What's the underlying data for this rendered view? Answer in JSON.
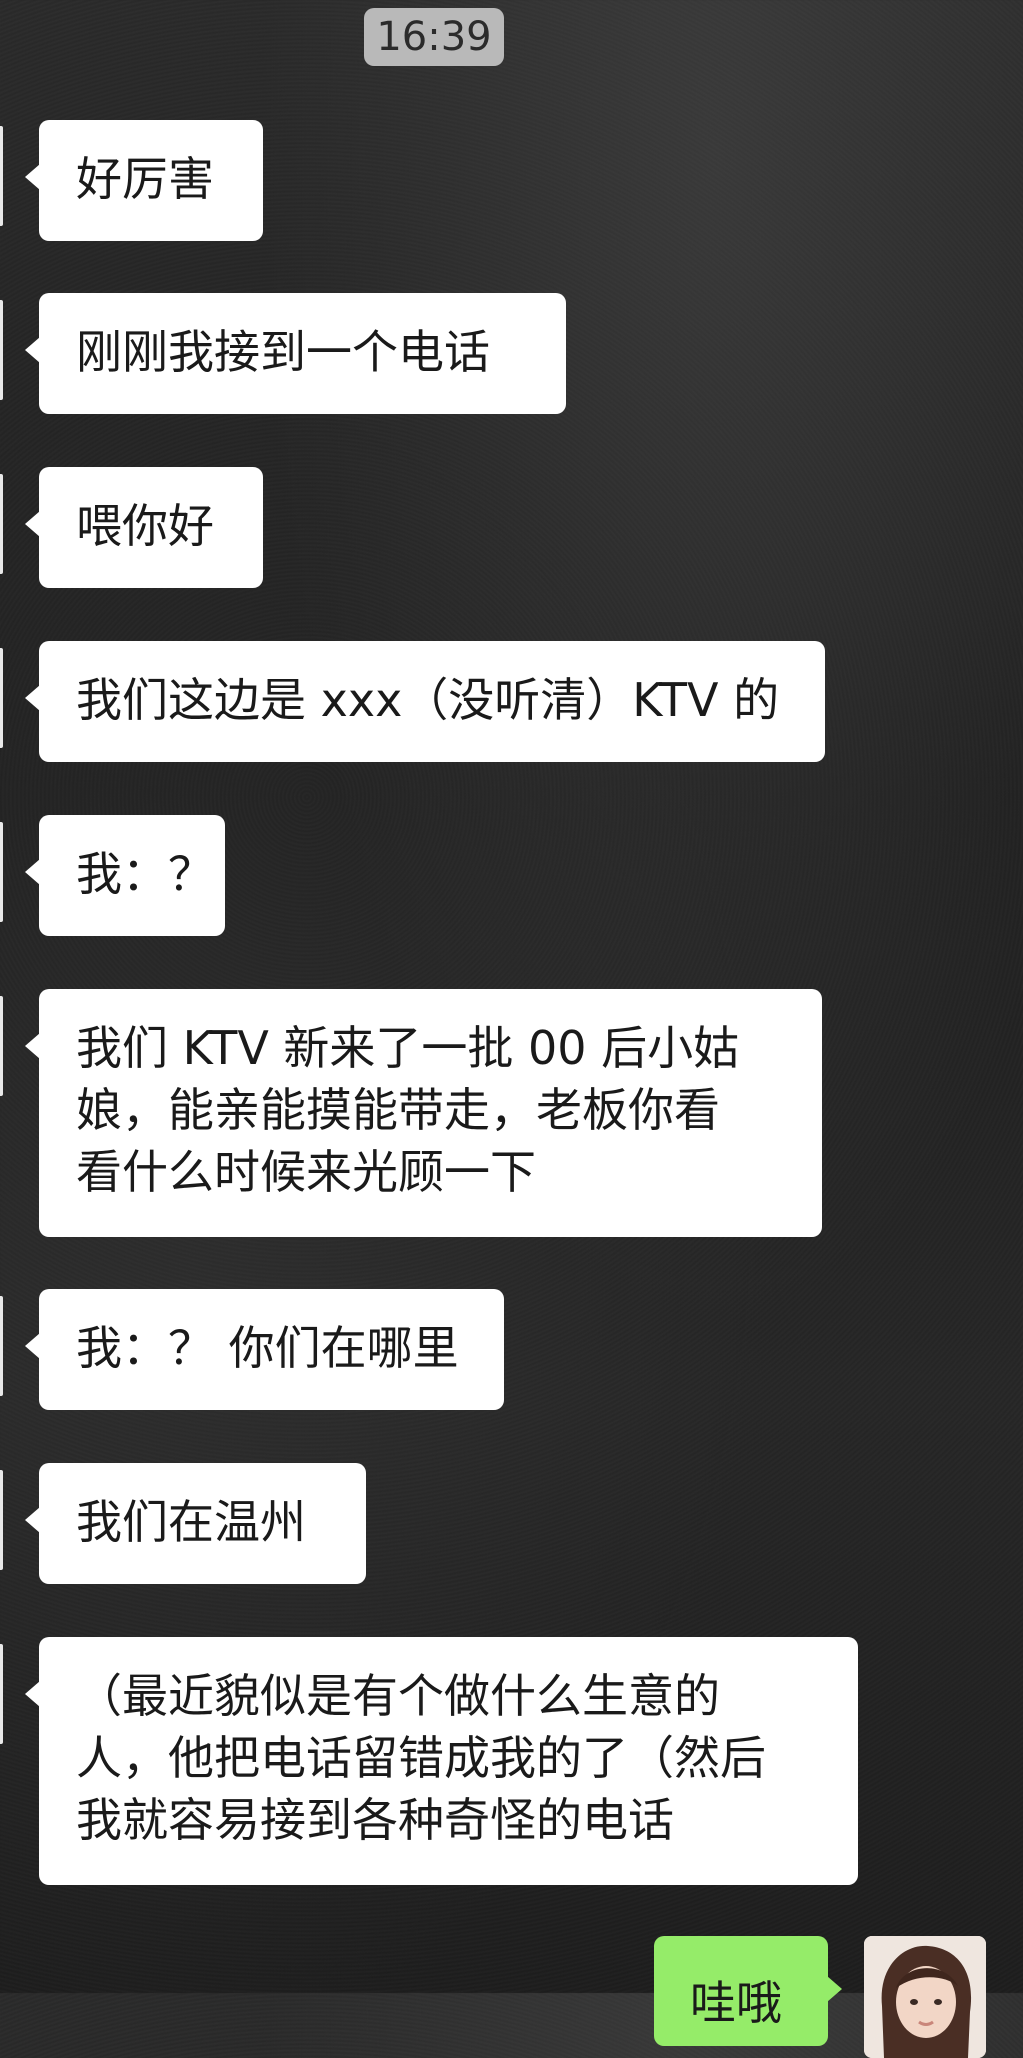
{
  "status": {
    "time": "16:39"
  },
  "messages": [
    {
      "side": "left",
      "text": "好厉害"
    },
    {
      "side": "left",
      "text": "刚刚我接到一个电话"
    },
    {
      "side": "left",
      "text": "喂你好"
    },
    {
      "side": "left",
      "text": "我们这边是 xxx（没听清）KTV 的"
    },
    {
      "side": "left",
      "text": "我：？"
    },
    {
      "side": "left",
      "text": "我们 KTV 新来了一批 00 后小姑\n娘，能亲能摸能带走，老板你看\n看什么时候来光顾一下"
    },
    {
      "side": "left",
      "text": "我：？ 你们在哪里"
    },
    {
      "side": "left",
      "text": "我们在温州"
    },
    {
      "side": "left",
      "text": "（最近貌似是有个做什么生意的\n人，他把电话留错成我的了（然后\n我就容易接到各种奇怪的电话"
    },
    {
      "side": "right",
      "text": "哇哦"
    }
  ],
  "colors": {
    "incoming_bubble": "#ffffff",
    "outgoing_bubble": "#95ec69",
    "timestamp_bg": "#b9b9b9"
  }
}
